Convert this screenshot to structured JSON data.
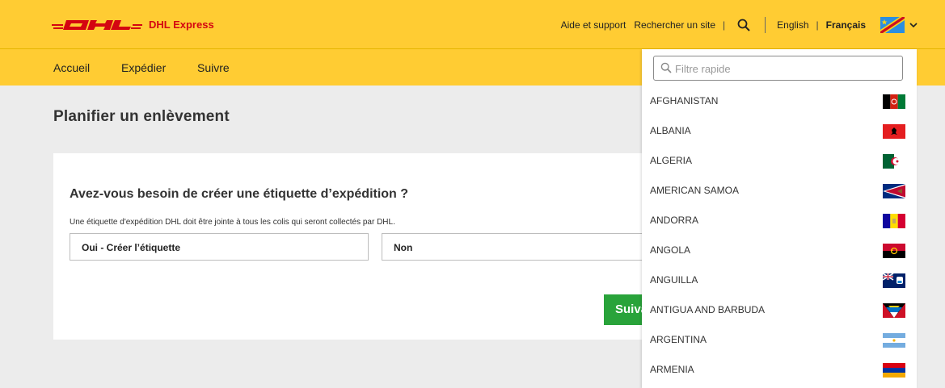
{
  "brand": {
    "sub": "DHL Express",
    "red": "#d40511",
    "yellow": "#ffcc33"
  },
  "toplinks": {
    "help": "Aide et support",
    "find_site": "Rechercher un site",
    "lang_en": "English",
    "lang_fr": "Français"
  },
  "nav": {
    "home": "Accueil",
    "ship": "Expédier",
    "track": "Suivre"
  },
  "page": {
    "title": "Planifier un enlèvement"
  },
  "card": {
    "question": "Avez-vous besoin de créer une étiquette d’expédition ?",
    "note": "Une étiquette d'expédition DHL doit être jointe à tous les colis qui seront collectés par DHL.",
    "option_yes": "Oui - Créer l’étiquette",
    "option_no": "Non",
    "next_label": "Suivant",
    "next_color": "#29a33a"
  },
  "dropdown": {
    "filter_placeholder": "Filtre rapide",
    "filter_value": "",
    "countries": [
      {
        "name": "AFGHANISTAN",
        "flag": "afghanistan-flag-icon"
      },
      {
        "name": "ALBANIA",
        "flag": "albania-flag-icon"
      },
      {
        "name": "ALGERIA",
        "flag": "algeria-flag-icon"
      },
      {
        "name": "AMERICAN SAMOA",
        "flag": "american-samoa-flag-icon"
      },
      {
        "name": "ANDORRA",
        "flag": "andorra-flag-icon"
      },
      {
        "name": "ANGOLA",
        "flag": "angola-flag-icon"
      },
      {
        "name": "ANGUILLA",
        "flag": "anguilla-flag-icon"
      },
      {
        "name": "ANTIGUA AND BARBUDA",
        "flag": "antigua-and-barbuda-flag-icon"
      },
      {
        "name": "ARGENTINA",
        "flag": "argentina-flag-icon"
      },
      {
        "name": "ARMENIA",
        "flag": "armenia-flag-icon"
      }
    ]
  }
}
